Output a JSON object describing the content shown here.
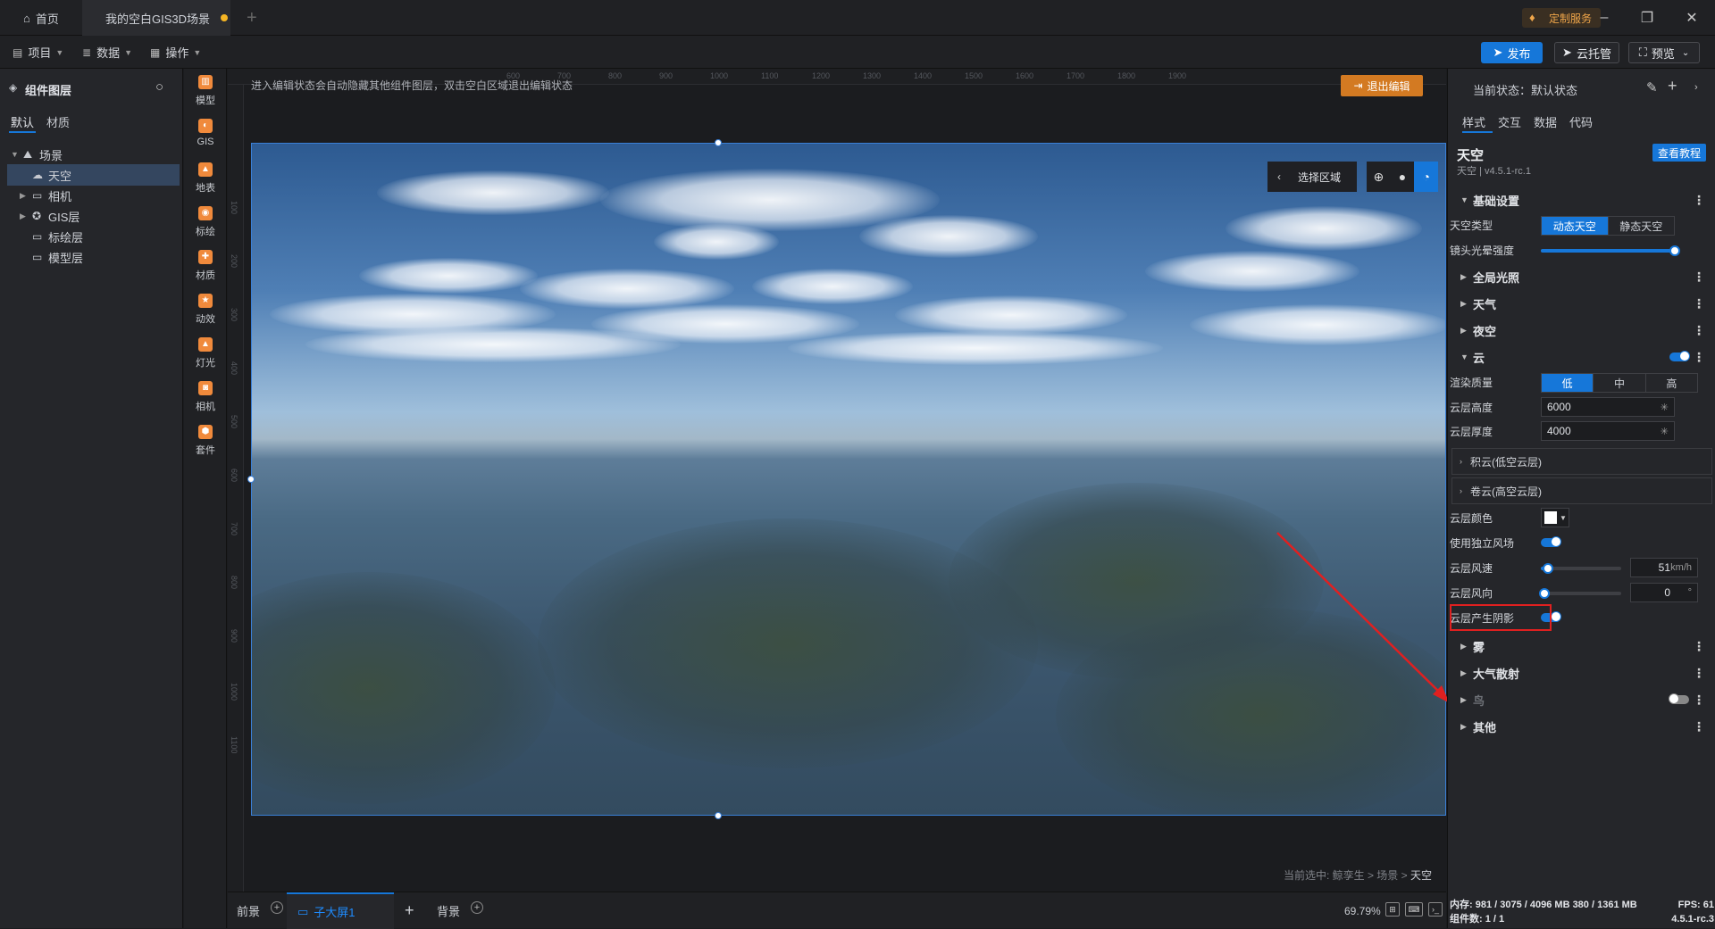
{
  "titlebar": {
    "home_tab": "首页",
    "scene_tab": "我的空白GIS3D场景",
    "custom_service": "定制服务"
  },
  "menubar": {
    "project": "项目",
    "data": "数据",
    "operate": "操作",
    "publish": "发布",
    "cloud_host": "云托管",
    "preview": "预览"
  },
  "layers": {
    "title": "组件图层",
    "tabs": [
      "默认",
      "材质"
    ],
    "tree": [
      {
        "label": "场景",
        "level": 0,
        "expanded": true,
        "selected": false
      },
      {
        "label": "天空",
        "level": 1,
        "expanded": false,
        "selected": true
      },
      {
        "label": "相机",
        "level": 1,
        "expanded": false,
        "selected": false
      },
      {
        "label": "GIS层",
        "level": 1,
        "expanded": false,
        "selected": false
      },
      {
        "label": "标绘层",
        "level": 1,
        "expanded": false,
        "selected": false
      },
      {
        "label": "模型层",
        "level": 1,
        "expanded": false,
        "selected": false
      }
    ]
  },
  "tools": [
    "模型",
    "GIS",
    "地表",
    "标绘",
    "材质",
    "动效",
    "灯光",
    "相机",
    "套件"
  ],
  "canvas": {
    "hint": "进入编辑状态会自动隐藏其他组件图层，双击空白区域退出编辑状态",
    "exit_edit": "退出编辑",
    "select_region": "选择区域",
    "breadcrumb_prefix": "当前选中: 鲸孪生 > 场景 > ",
    "breadcrumb_current": "天空",
    "ruler_top": [
      "600",
      "700",
      "800",
      "900",
      "1000",
      "1100",
      "1200",
      "1300",
      "1400",
      "1500",
      "1600",
      "1700",
      "1800",
      "1900"
    ],
    "ruler_left": [
      "100",
      "200",
      "300",
      "400",
      "500",
      "600",
      "700",
      "800",
      "900",
      "1000",
      "1100"
    ]
  },
  "bottombar": {
    "foreground": "前景",
    "screen": "子大屏1",
    "background": "背景",
    "zoom": "69.79%"
  },
  "props": {
    "status": "当前状态：默认状态",
    "tabs": [
      "样式",
      "交互",
      "数据",
      "代码"
    ],
    "component_name": "天空",
    "component_version": "天空 | v4.5.1-rc.1",
    "tutorial": "查看教程",
    "basic_settings": "基础设置",
    "sky_type_label": "天空类型",
    "sky_type_options": [
      "动态天空",
      "静态天空"
    ],
    "lens_flare_label": "镜头光晕强度",
    "lens_flare_value": 1.0,
    "global_light": "全局光照",
    "weather": "天气",
    "night_sky": "夜空",
    "cloud": "云",
    "render_quality_label": "渲染质量",
    "render_quality_options": [
      "低",
      "中",
      "高"
    ],
    "cloud_height_label": "云层高度",
    "cloud_height": "6000",
    "cloud_thickness_label": "云层厚度",
    "cloud_thickness": "4000",
    "cumulus": "积云(低空云层)",
    "cirrus": "卷云(高空云层)",
    "cloud_color_label": "云层颜色",
    "cloud_color": "#ffffff",
    "independent_wind_label": "使用独立风场",
    "wind_speed_label": "云层风速",
    "wind_speed": "51",
    "wind_speed_unit": "km/h",
    "wind_dir_label": "云层风向",
    "wind_dir": "0",
    "wind_dir_unit": "°",
    "cast_shadow_label": "云层产生阴影",
    "fog": "雾",
    "atmosphere": "大气散射",
    "bird": "鸟",
    "other": "其他",
    "perf_line1_left": "内存:  981 / 3075 / 4096 MB  380 / 1361 MB",
    "perf_line1_right": "FPS:  61",
    "perf_line2_left": "组件数: 1 / 1",
    "perf_line2_right": "4.5.1-rc.3"
  },
  "colors": {
    "accent": "#1677d9",
    "exit_edit": "#d37a22",
    "annotation": "#e02020"
  }
}
